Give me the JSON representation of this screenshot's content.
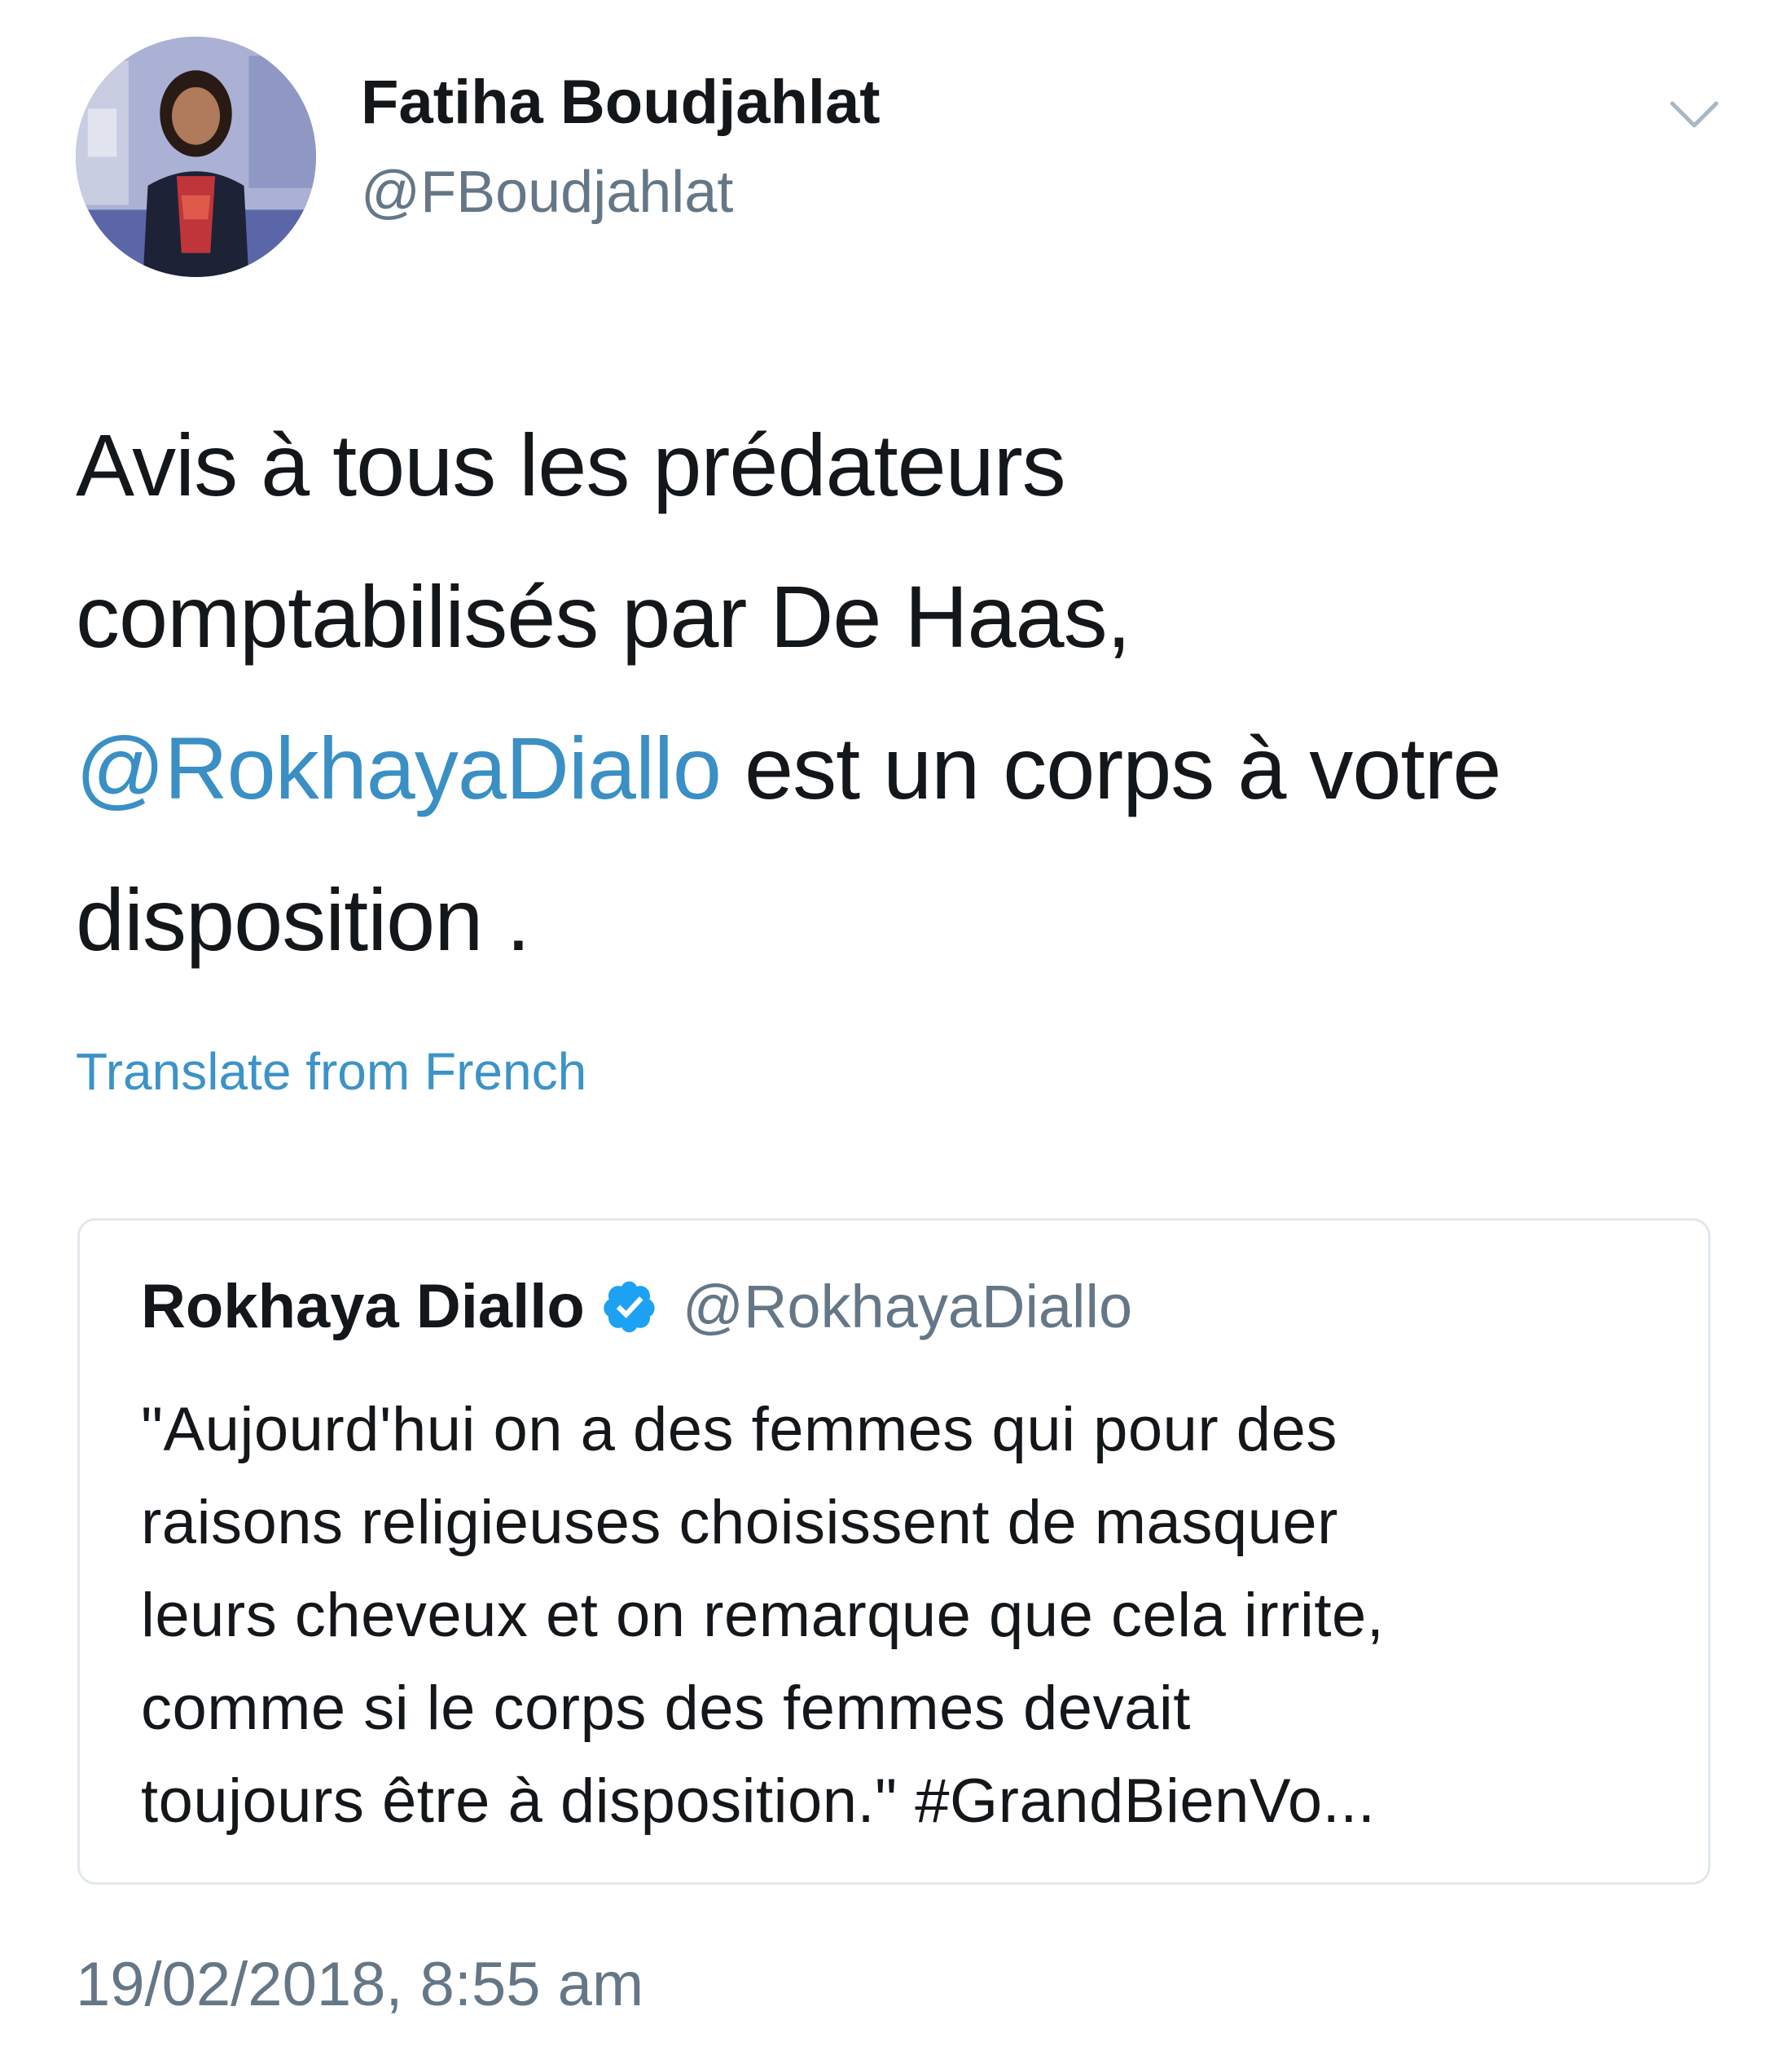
{
  "tweet": {
    "author_name": "Fatiha Boudjahlat",
    "author_handle": "@FBoudjahlat",
    "text_lines": [
      "Avis à tous les prédateurs",
      "comptabilisés par De Haas,"
    ],
    "mention": "@RokhayaDiallo",
    "text_after_mention": " est un corps à votre",
    "text_last_line": "disposition .",
    "translate_label": "Translate from French",
    "timestamp": "19/02/2018, 8:55 am",
    "mention_color": "#3a8fc4"
  },
  "quoted": {
    "author_name": "Rokhaya Diallo",
    "verified": true,
    "verified_icon": "verified-badge-icon",
    "author_handle": "@RokhayaDiallo",
    "text_lines": [
      "\"Aujourd'hui on a des femmes qui pour des",
      "raisons religieuses choisissent de masquer",
      "leurs cheveux et on remarque que cela irrite,",
      "comme si le corps des femmes devait",
      "toujours être à disposition.\" #GrandBienVo..."
    ]
  },
  "icons": {
    "menu": "chevron-down-icon",
    "avatar": "profile-photo"
  },
  "colors": {
    "link": "#3d93c7",
    "secondary_text": "#657786",
    "verified": "#1da1f2"
  }
}
